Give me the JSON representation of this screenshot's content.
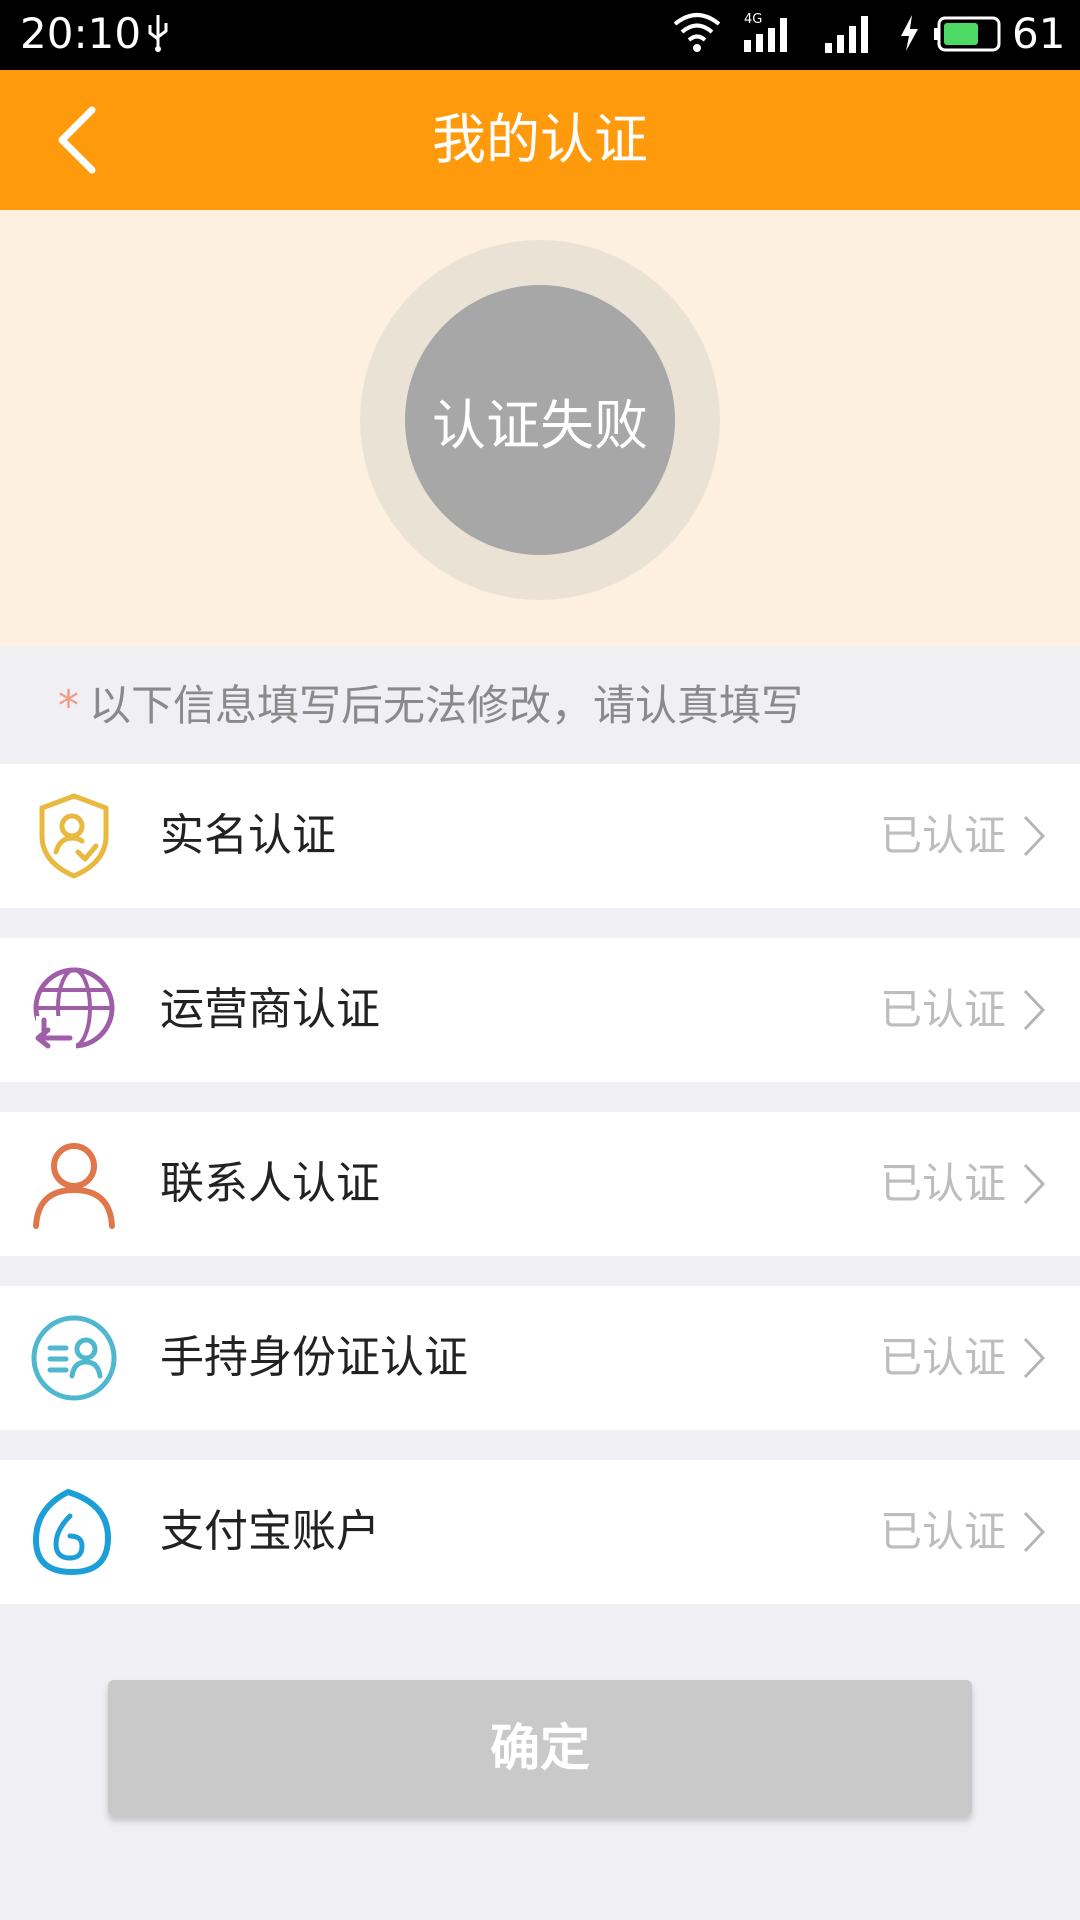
{
  "status_bar": {
    "time": "20:10",
    "network_type": "4G",
    "battery_level": "61"
  },
  "header": {
    "title": "我的认证",
    "back_icon": "chevron-left-icon"
  },
  "hero": {
    "status_text": "认证失败"
  },
  "notice": {
    "asterisk": "*",
    "text": "以下信息填写后无法修改，请认真填写"
  },
  "items": [
    {
      "label": "实名认证",
      "status": "已认证",
      "icon": "shield-user-icon",
      "color": "#e8b93e"
    },
    {
      "label": "运营商认证",
      "status": "已认证",
      "icon": "globe-refresh-icon",
      "color": "#a05ea8"
    },
    {
      "label": "联系人认证",
      "status": "已认证",
      "icon": "person-icon",
      "color": "#e0774a"
    },
    {
      "label": "手持身份证认证",
      "status": "已认证",
      "icon": "id-card-icon",
      "color": "#4fb7d0"
    },
    {
      "label": "支付宝账户",
      "status": "已认证",
      "icon": "alipay-drop-icon",
      "color": "#1c9fd8"
    }
  ],
  "confirm_button": {
    "label": "确定"
  },
  "colors": {
    "accent": "#ff9a0c",
    "hero_bg": "#fdf0e0",
    "failed_gray": "#a7a7a7",
    "page_bg": "#efeff4"
  }
}
